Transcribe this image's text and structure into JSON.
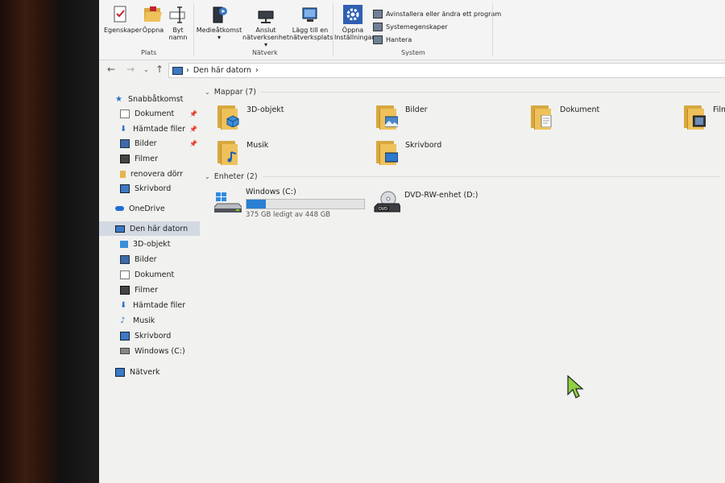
{
  "ribbon": {
    "groups": {
      "plats": "Plats",
      "natverk": "Nätverk",
      "system": "System"
    },
    "buttons": {
      "egenskaper": "Egenskaper",
      "oppna": "Öppna",
      "byt_namn_1": "Byt",
      "byt_namn_2": "namn",
      "mediaatkomst": "Medieåtkomst",
      "anslut_1": "Anslut",
      "anslut_2": "nätverksenhet",
      "lagg_till_1": "Lägg till en",
      "lagg_till_2": "nätverksplats",
      "oppna_inst_1": "Öppna",
      "oppna_inst_2": "Inställningar"
    },
    "system_items": [
      "Avinstallera eller ändra ett program",
      "Systemegenskaper",
      "Hantera"
    ]
  },
  "address": {
    "path": "Den här datorn",
    "separator": "›"
  },
  "sidebar": {
    "items": [
      {
        "label": "Snabbåtkomst",
        "pinned": false
      },
      {
        "label": "Dokument",
        "pinned": true
      },
      {
        "label": "Hämtade filer",
        "pinned": true
      },
      {
        "label": "Bilder",
        "pinned": true
      },
      {
        "label": "Filmer",
        "pinned": false
      },
      {
        "label": "renovera dörr",
        "pinned": false
      },
      {
        "label": "Skrivbord",
        "pinned": false
      },
      {
        "label": "OneDrive",
        "pinned": false
      },
      {
        "label": "Den här datorn",
        "pinned": false,
        "selected": true
      },
      {
        "label": "3D-objekt",
        "pinned": false
      },
      {
        "label": "Bilder",
        "pinned": false
      },
      {
        "label": "Dokument",
        "pinned": false
      },
      {
        "label": "Filmer",
        "pinned": false
      },
      {
        "label": "Hämtade filer",
        "pinned": false
      },
      {
        "label": "Musik",
        "pinned": false
      },
      {
        "label": "Skrivbord",
        "pinned": false
      },
      {
        "label": "Windows (C:)",
        "pinned": false
      },
      {
        "label": "Nätverk",
        "pinned": false
      }
    ]
  },
  "folders_section": {
    "header": "Mappar (7)",
    "items": [
      "3D-objekt",
      "Bilder",
      "Dokument",
      "Filmer",
      "Musik",
      "Skrivbord"
    ]
  },
  "devices_section": {
    "header": "Enheter (2)",
    "drives": [
      {
        "name": "Windows (C:)",
        "free_text": "375 GB ledigt av 448 GB",
        "used_fraction": 0.163
      },
      {
        "name": "DVD-RW-enhet (D:)"
      }
    ]
  },
  "colors": {
    "accent": "#2a7fd4",
    "folder": "#eec15a",
    "selected": "#d3d9e2"
  }
}
